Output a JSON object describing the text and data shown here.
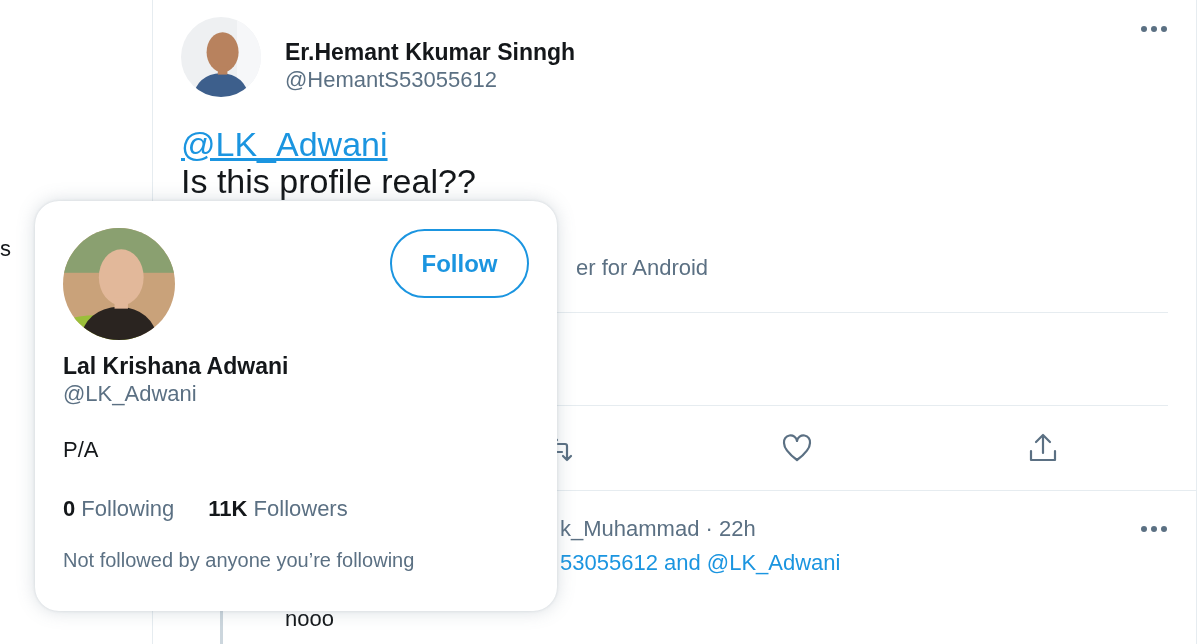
{
  "sidebar": {
    "fragment": "s"
  },
  "tweet": {
    "author": {
      "name": "Er.Hemant Kkumar Sinngh",
      "handle": "@HemantS53055612"
    },
    "mention": "@LK_Adwani",
    "text": "Is this profile real??",
    "source": "er for Android",
    "actions": [
      {
        "kind": "retweet"
      },
      {
        "kind": "like"
      },
      {
        "kind": "share"
      }
    ]
  },
  "reply": {
    "meta": "k_Muhammad · 22h",
    "replying_to": "53055612 and @LK_Adwani",
    "text": "nooo"
  },
  "hover_card": {
    "name": "Lal Krishana Adwani",
    "handle": "@LK_Adwani",
    "follow_button": "Follow",
    "bio": "P/A",
    "stats": [
      {
        "count": "0",
        "label": "Following"
      },
      {
        "count": "11K",
        "label": "Followers"
      }
    ],
    "note": "Not followed by anyone you’re following"
  }
}
